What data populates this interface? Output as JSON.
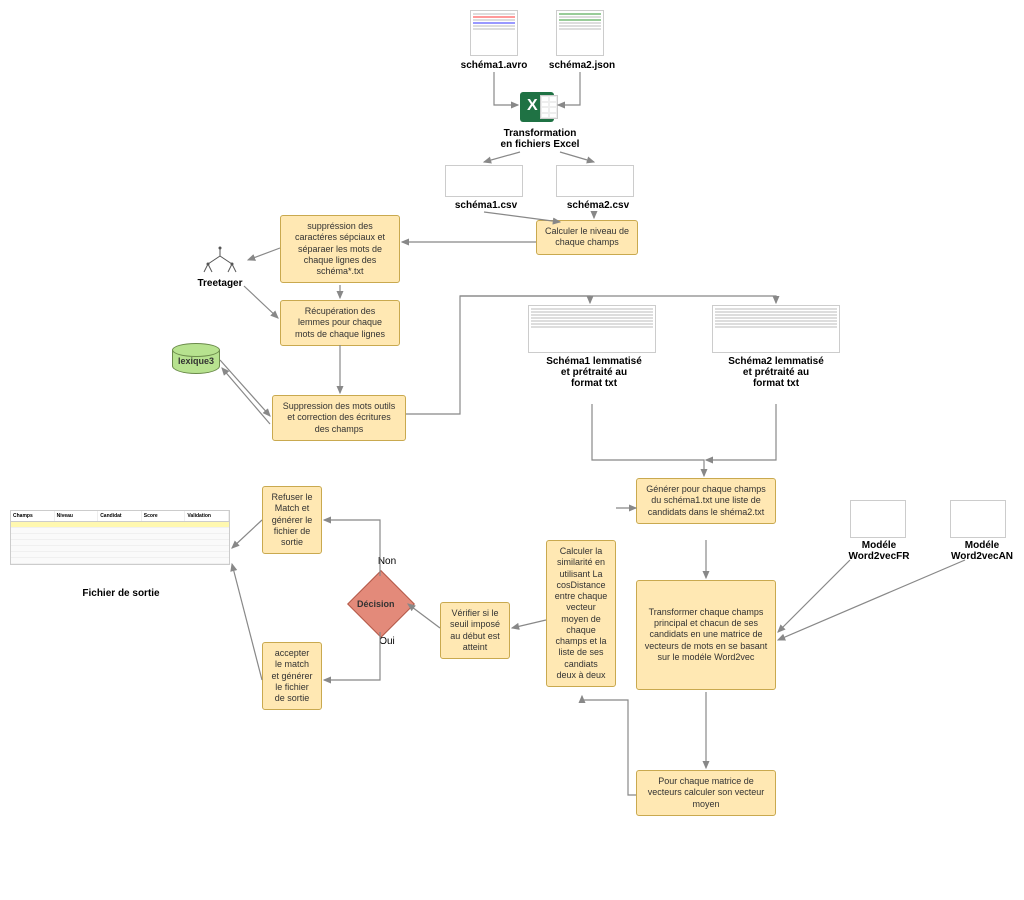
{
  "inputs": {
    "file1": "schéma1.avro",
    "file2": "schéma2.json",
    "csv1": "schéma1.csv",
    "csv2": "schéma2.csv"
  },
  "transform_excel": "Transformation\nen fichiers Excel",
  "calc_level": "Calculer le niveau de chaque champs",
  "suppress_special": "suppréssion des caractéres sépciaux et séparaer les mots de chaque lignes des schéma*.txt",
  "treetagger": "Treetager",
  "recup_lemmes": "Récupération des lemmes pour chaque mots de chaque lignes",
  "lexique3": "lexique3",
  "suppress_tools": "Suppression des mots outils et correction des écritures des champs",
  "schema1_lemma": "Schéma1 lemmatisé et prétraité au format txt",
  "schema2_lemma": "Schéma2 lemmatisé et prétraité au format txt",
  "generate_candidates": "Générer pour chaque champs du schéma1.txt une liste de candidats dans le shéma2.txt",
  "model_fr": "Modéle Word2vecFR",
  "model_an": "Modéle Word2vecAN",
  "transform_vectors": "Transformer chaque champs principal et chacun de ses candidats en une matrice de vecteurs de mots en se basant sur le modéle Word2vec",
  "mean_vector": "Pour chaque matrice de vecteurs calculer son vecteur moyen",
  "cos_similarity": "Calculer la similarité en utilisant La cosDistance entre chaque vecteur moyen de chaque champs et la liste de ses candiats deux à deux",
  "verify_threshold": "Vérifier si le seuil imposé au début est atteint",
  "decision": {
    "label": "Décision",
    "no": "Non",
    "yes": "Oui"
  },
  "refuse_match": "Refuser le Match et générer le fichier de sortie",
  "accept_match": "accepter le match et générer le fichier de sortie",
  "output_file": "Fichier de sortie",
  "output_columns": [
    "Champs",
    "Niveau",
    "Candidat",
    "Score",
    "Validation"
  ]
}
